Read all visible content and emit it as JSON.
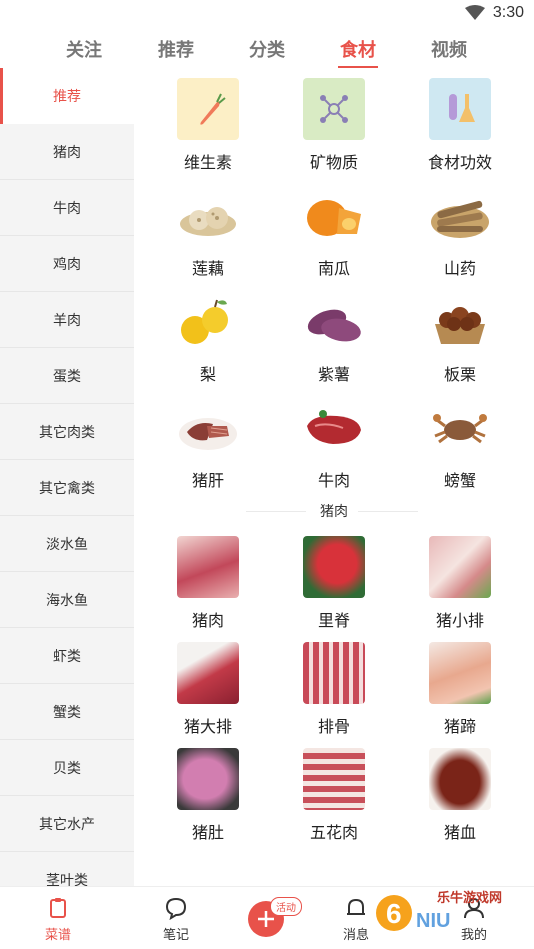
{
  "status_bar": {
    "time": "3:30"
  },
  "top_tabs": [
    {
      "label": "关注"
    },
    {
      "label": "推荐"
    },
    {
      "label": "分类"
    },
    {
      "label": "食材",
      "active": true
    },
    {
      "label": "视频"
    }
  ],
  "sidebar": {
    "items": [
      {
        "label": "推荐",
        "active": true
      },
      {
        "label": "猪肉"
      },
      {
        "label": "牛肉"
      },
      {
        "label": "鸡肉"
      },
      {
        "label": "羊肉"
      },
      {
        "label": "蛋类"
      },
      {
        "label": "其它肉类"
      },
      {
        "label": "其它禽类"
      },
      {
        "label": "淡水鱼"
      },
      {
        "label": "海水鱼"
      },
      {
        "label": "虾类"
      },
      {
        "label": "蟹类"
      },
      {
        "label": "贝类"
      },
      {
        "label": "其它水产"
      },
      {
        "label": "茎叶类"
      }
    ]
  },
  "recommend": {
    "items": [
      {
        "label": "维生素",
        "icon": "carrot-icon"
      },
      {
        "label": "矿物质",
        "icon": "molecule-icon"
      },
      {
        "label": "食材功效",
        "icon": "flask-icon"
      },
      {
        "label": "莲藕",
        "icon": "lotus-root-image"
      },
      {
        "label": "南瓜",
        "icon": "pumpkin-image"
      },
      {
        "label": "山药",
        "icon": "yam-image"
      },
      {
        "label": "梨",
        "icon": "pear-image"
      },
      {
        "label": "紫薯",
        "icon": "purple-potato-image"
      },
      {
        "label": "板栗",
        "icon": "chestnut-image"
      },
      {
        "label": "猪肝",
        "icon": "pork-liver-image"
      },
      {
        "label": "牛肉",
        "icon": "beef-image"
      },
      {
        "label": "螃蟹",
        "icon": "crab-image"
      }
    ]
  },
  "pork_section": {
    "title": "猪肉",
    "items": [
      {
        "label": "猪肉"
      },
      {
        "label": "里脊"
      },
      {
        "label": "猪小排"
      },
      {
        "label": "猪大排"
      },
      {
        "label": "排骨"
      },
      {
        "label": "猪蹄"
      },
      {
        "label": "猪肚"
      },
      {
        "label": "五花肉"
      },
      {
        "label": "猪血"
      }
    ]
  },
  "bottom_nav": {
    "items": [
      {
        "label": "菜谱",
        "active": true
      },
      {
        "label": "笔记"
      },
      {
        "label": "消息"
      },
      {
        "label": "我的"
      }
    ],
    "plus_badge": "活动"
  },
  "watermark": {
    "text": "乐牛游戏网"
  },
  "colors": {
    "accent": "#e8524a",
    "sidebar_bg": "#f4f4f4"
  }
}
